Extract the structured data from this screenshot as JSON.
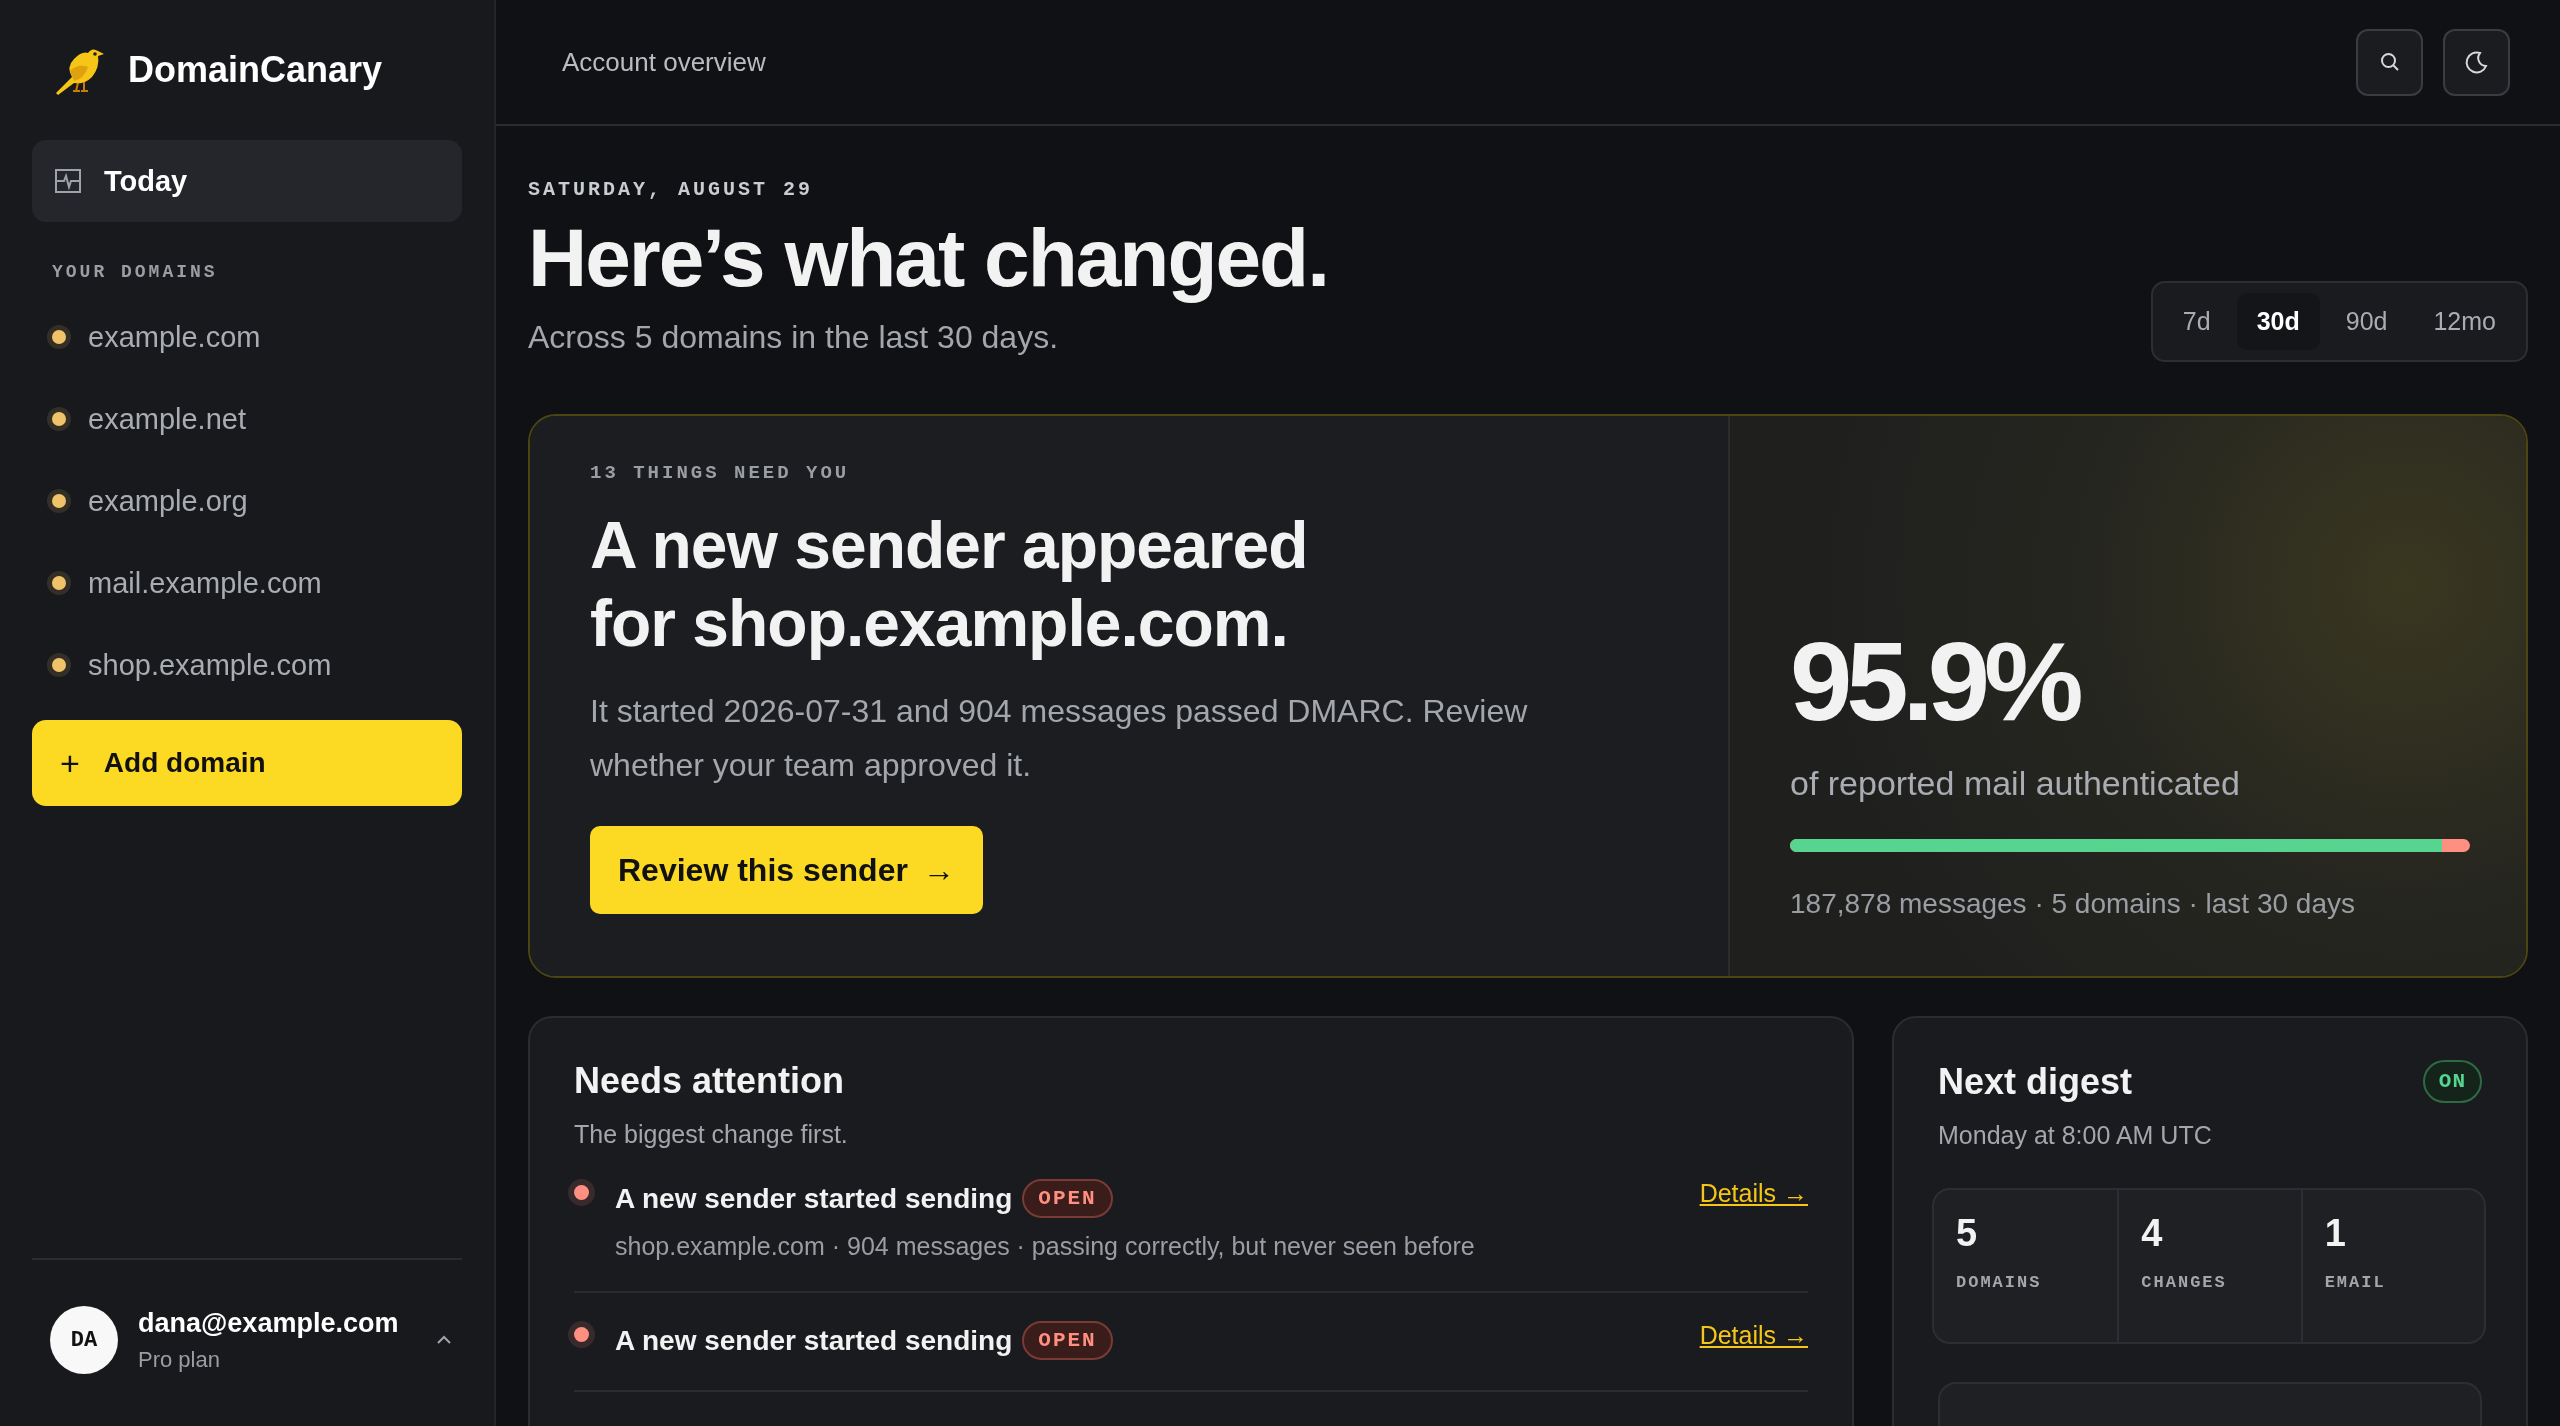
{
  "brand": {
    "name": "DomainCanary"
  },
  "nav": [
    {
      "label": "Today",
      "selected": true
    }
  ],
  "domains_heading": "YOUR DOMAINS",
  "domains": [
    {
      "name": "example.com",
      "color": "#f0c36a"
    },
    {
      "name": "example.net",
      "color": "#f0c36a"
    },
    {
      "name": "example.org",
      "color": "#f0c36a"
    },
    {
      "name": "mail.example.com",
      "color": "#f0c36a"
    },
    {
      "name": "shop.example.com",
      "color": "#f0c36a"
    }
  ],
  "add_button": {
    "icon": "+",
    "label": "Add domain"
  },
  "user": {
    "initials": "DA",
    "email": "dana@example.com",
    "plan": "Pro plan",
    "expanded": true
  },
  "header": {
    "title": "Account overview"
  },
  "date": "SATURDAY, AUGUST 29",
  "heading": "Here’s what changed.",
  "subheading": "Across 5 domains in the last 30 days.",
  "ranges": [
    {
      "label": "7d",
      "selected": false
    },
    {
      "label": "30d",
      "selected": true
    },
    {
      "label": "90d",
      "selected": false
    },
    {
      "label": "12mo",
      "selected": false
    }
  ],
  "hero": {
    "eyebrow": "13 THINGS NEED YOU",
    "title_lines": [
      "A new sender appeared",
      "for shop.example.com."
    ],
    "body": "It started 2026-07-31 and 904 messages passed DMARC. Review whether your team approved it.",
    "button": "Review this sender",
    "button_arrow": "→"
  },
  "auth": {
    "value": "95.9%",
    "caption": "of reported mail authenticated",
    "level": 0.959,
    "footer": "187,878 messages · 5 domains · last 30 days"
  },
  "attention": {
    "title": "Needs attention",
    "subtitle": "The biggest change first.",
    "items": [
      {
        "title": "A new sender started sending",
        "badge": "OPEN",
        "color": "#ff8f80",
        "meta": "shop.example.com · 904 messages · passing correctly, but never seen before",
        "link": "Details →"
      },
      {
        "title": "A new sender started sending",
        "badge": "OPEN",
        "color": "#ff8f80",
        "link": "Details →"
      }
    ]
  },
  "digest": {
    "title": "Next digest",
    "status": "ON",
    "schedule": "Monday at 8:00 AM UTC",
    "stats": [
      {
        "value": "5",
        "label": "DOMAINS"
      },
      {
        "value": "4",
        "label": "CHANGES"
      },
      {
        "value": "1",
        "label": "EMAIL"
      }
    ]
  }
}
